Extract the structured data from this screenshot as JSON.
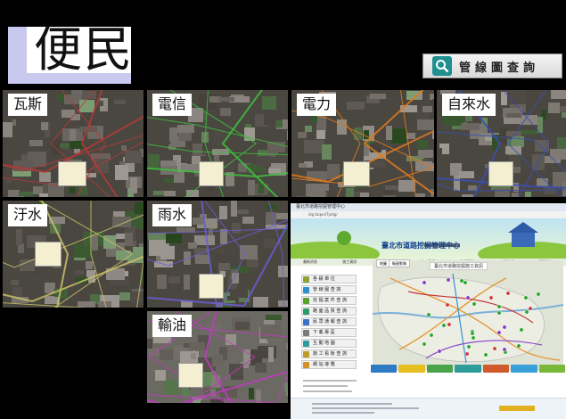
{
  "header": {
    "title": "便民",
    "query_button_label": "管線圖查詢"
  },
  "tiles": [
    {
      "label": "瓦斯",
      "line_color": "#b53a3a"
    },
    {
      "label": "電信",
      "line_color": "#3fbf3f"
    },
    {
      "label": "電力",
      "line_color": "#e07a1e"
    },
    {
      "label": "自來水",
      "line_color": "#3a4fb5"
    },
    {
      "label": "汙水",
      "line_color": "#c9c16a"
    },
    {
      "label": "雨水",
      "line_color": "#6a5ed6"
    },
    {
      "label": "輸油",
      "line_color": "#c23ac2"
    }
  ],
  "browser": {
    "tab_label": "臺北市道路挖掘管理中心",
    "url": "dig.taipei/Tpdig/",
    "banner_title": "臺北市道路挖掘管理中心",
    "nav_items": [
      "最新消息",
      "施工資訊",
      "圖資查詢",
      "施工監督",
      "法規資料",
      "申請作業",
      "管理系統"
    ],
    "map_tabs": [
      "地圖",
      "衛星影像"
    ],
    "map_title": "臺北市道路挖掘施工資訊",
    "menu_items": [
      {
        "label": "各 級 單 位",
        "color": "#8aa536"
      },
      {
        "label": "管 線 圖 查 詢",
        "color": "#2f8fd0"
      },
      {
        "label": "挖 掘 案 件 查 詢",
        "color": "#5aa02c"
      },
      {
        "label": "路 面 品 質 查 詢",
        "color": "#2c9a6a"
      },
      {
        "label": "民 眾 通 報 查 詢",
        "color": "#3d6fc4"
      },
      {
        "label": "下 載 專 區",
        "color": "#7a7a7a"
      },
      {
        "label": "互 動 地 圖",
        "color": "#2f9c9c"
      },
      {
        "label": "施 工 看 板 查 詢",
        "color": "#c09a2a"
      },
      {
        "label": "網 站 導 覽",
        "color": "#d0902a"
      }
    ]
  }
}
